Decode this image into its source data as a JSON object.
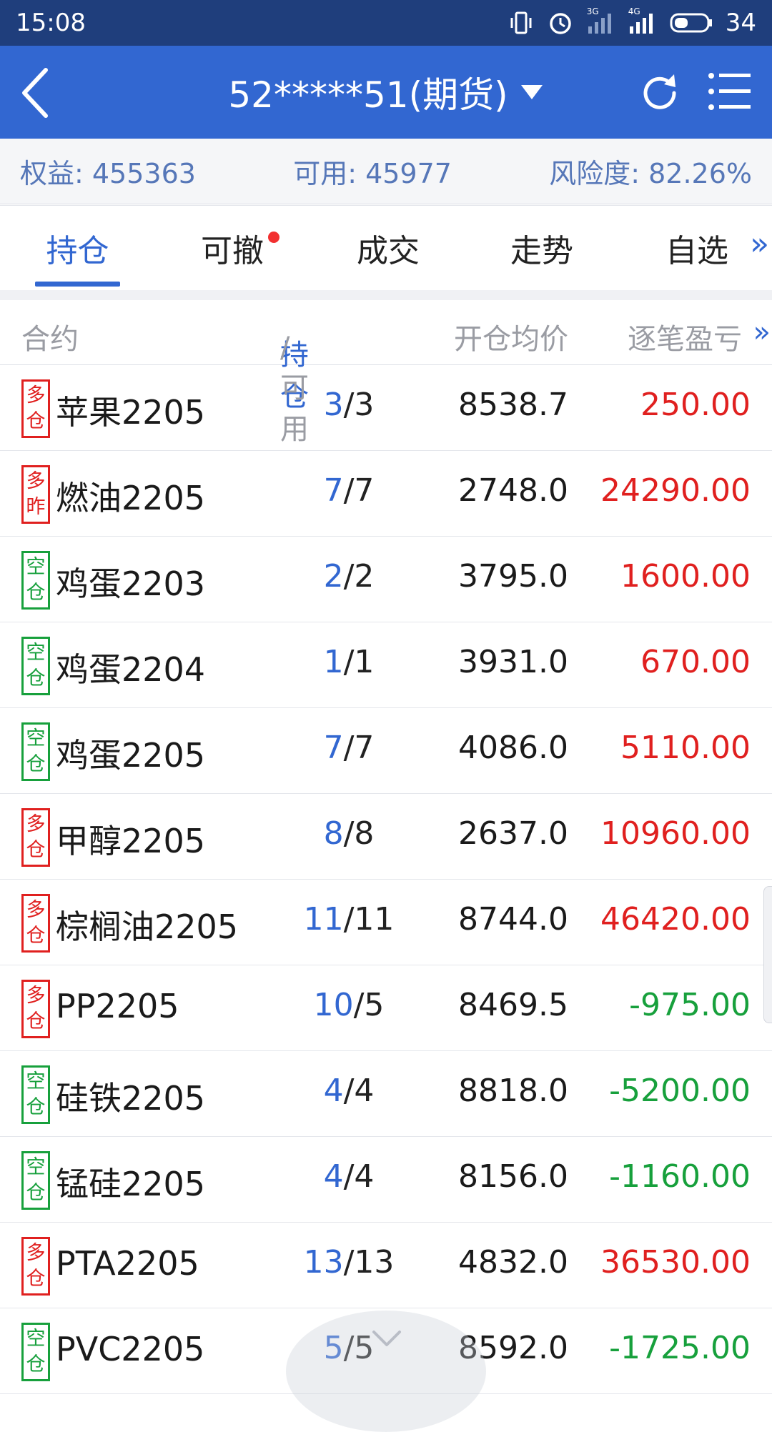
{
  "status_bar": {
    "time": "15:08",
    "net1": "3G",
    "net2": "4G",
    "battery": "34"
  },
  "header": {
    "title": "52*****51(期货)"
  },
  "summary": {
    "equity": "权益: 455363",
    "available": "可用: 45977",
    "risk": "风险度: 82.26%"
  },
  "tabs": [
    {
      "label": "持仓",
      "active": true
    },
    {
      "label": "可撤",
      "dot": true
    },
    {
      "label": "成交"
    },
    {
      "label": "走势"
    },
    {
      "label": "自选"
    }
  ],
  "tabs_more": "»",
  "table": {
    "headers": {
      "contract": "合约",
      "position_hl": "持仓",
      "position_rest": "/可用",
      "avg_price": "开仓均价",
      "pnl": "逐笔盈亏",
      "more": "»"
    },
    "rows": [
      {
        "badge": [
          "多",
          "仓"
        ],
        "side": "long",
        "name": "苹果2205",
        "hold": "3",
        "avail": "/3",
        "avg": "8538.7",
        "pnl": "250.00",
        "pnl_sign": "pos"
      },
      {
        "badge": [
          "多",
          "昨"
        ],
        "side": "long",
        "name": "燃油2205",
        "hold": "7",
        "avail": "/7",
        "avg": "2748.0",
        "pnl": "24290.00",
        "pnl_sign": "pos"
      },
      {
        "badge": [
          "空",
          "仓"
        ],
        "side": "short",
        "name": "鸡蛋2203",
        "hold": "2",
        "avail": "/2",
        "avg": "3795.0",
        "pnl": "1600.00",
        "pnl_sign": "pos"
      },
      {
        "badge": [
          "空",
          "仓"
        ],
        "side": "short",
        "name": "鸡蛋2204",
        "hold": "1",
        "avail": "/1",
        "avg": "3931.0",
        "pnl": "670.00",
        "pnl_sign": "pos"
      },
      {
        "badge": [
          "空",
          "仓"
        ],
        "side": "short",
        "name": "鸡蛋2205",
        "hold": "7",
        "avail": "/7",
        "avg": "4086.0",
        "pnl": "5110.00",
        "pnl_sign": "pos"
      },
      {
        "badge": [
          "多",
          "仓"
        ],
        "side": "long",
        "name": "甲醇2205",
        "hold": "8",
        "avail": "/8",
        "avg": "2637.0",
        "pnl": "10960.00",
        "pnl_sign": "pos"
      },
      {
        "badge": [
          "多",
          "仓"
        ],
        "side": "long",
        "name": "棕榈油2205",
        "hold": "11",
        "avail": "/11",
        "avg": "8744.0",
        "pnl": "46420.00",
        "pnl_sign": "pos"
      },
      {
        "badge": [
          "多",
          "仓"
        ],
        "side": "long",
        "name": "PP2205",
        "hold": "10",
        "avail": "/5",
        "avg": "8469.5",
        "pnl": "-975.00",
        "pnl_sign": "neg"
      },
      {
        "badge": [
          "空",
          "仓"
        ],
        "side": "short",
        "name": "硅铁2205",
        "hold": "4",
        "avail": "/4",
        "avg": "8818.0",
        "pnl": "-5200.00",
        "pnl_sign": "neg"
      },
      {
        "badge": [
          "空",
          "仓"
        ],
        "side": "short",
        "name": "锰硅2205",
        "hold": "4",
        "avail": "/4",
        "avg": "8156.0",
        "pnl": "-1160.00",
        "pnl_sign": "neg"
      },
      {
        "badge": [
          "多",
          "仓"
        ],
        "side": "long",
        "name": "PTA2205",
        "hold": "13",
        "avail": "/13",
        "avg": "4832.0",
        "pnl": "36530.00",
        "pnl_sign": "pos"
      },
      {
        "badge": [
          "空",
          "仓"
        ],
        "side": "short",
        "name": "PVC2205",
        "hold": "5",
        "avail": "/5",
        "avg": "8592.0",
        "pnl": "-1725.00",
        "pnl_sign": "neg"
      }
    ]
  },
  "colors": {
    "header_bg": "#3267d1",
    "status_bg": "#1f3e7c",
    "long": "#e0201f",
    "short": "#17a03c",
    "accent": "#3267d1"
  },
  "icons": [
    "vibrate-icon",
    "alarm-icon",
    "signal-icon",
    "battery-icon",
    "back-icon",
    "dropdown-icon",
    "refresh-icon",
    "menu-icon",
    "collapse-icon"
  ]
}
